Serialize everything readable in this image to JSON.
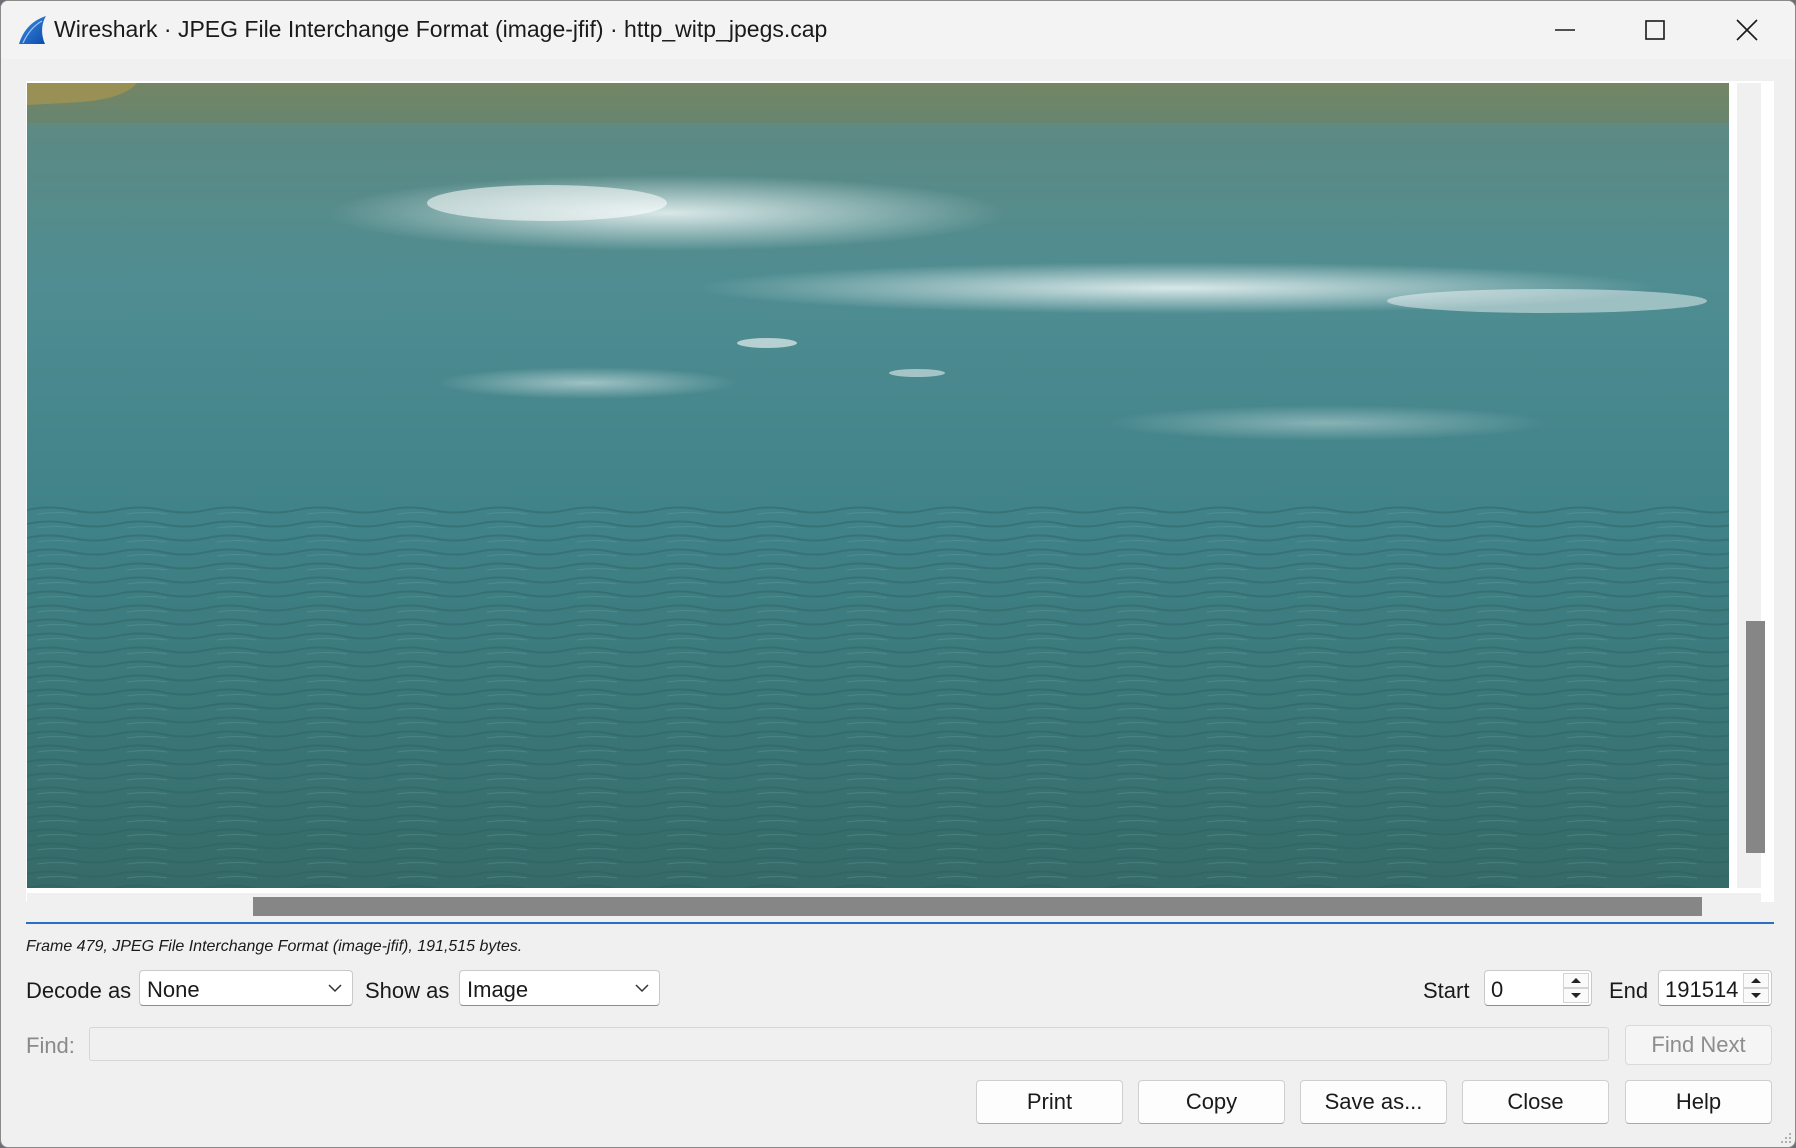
{
  "window": {
    "title": "Wireshark · JPEG File Interchange Format (image-jfif) · http_witp_jpegs.cap",
    "controls": [
      "minimize-icon",
      "maximize-icon",
      "close-icon"
    ]
  },
  "viewer": {
    "content": "image-preview",
    "vertical_scroll_position": 0.72,
    "horizontal_scroll_position": 0.87
  },
  "status": {
    "frame_info": "Frame 479, JPEG File Interchange Format (image-jfif), 191,515 bytes."
  },
  "controls": {
    "decode_as_label": "Decode as",
    "decode_as_value": "None",
    "show_as_label": "Show as",
    "show_as_value": "Image",
    "start_label": "Start",
    "start_value": "0",
    "end_label": "End",
    "end_value": "191514"
  },
  "find": {
    "label": "Find:",
    "value": "",
    "find_next_label": "Find Next"
  },
  "buttons": {
    "print": "Print",
    "copy": "Copy",
    "save_as": "Save as...",
    "close": "Close",
    "help": "Help"
  },
  "colors": {
    "accent_rule": "#2a6fc4",
    "water_dark": "#2f6f74",
    "water_light": "#4f8f96"
  }
}
